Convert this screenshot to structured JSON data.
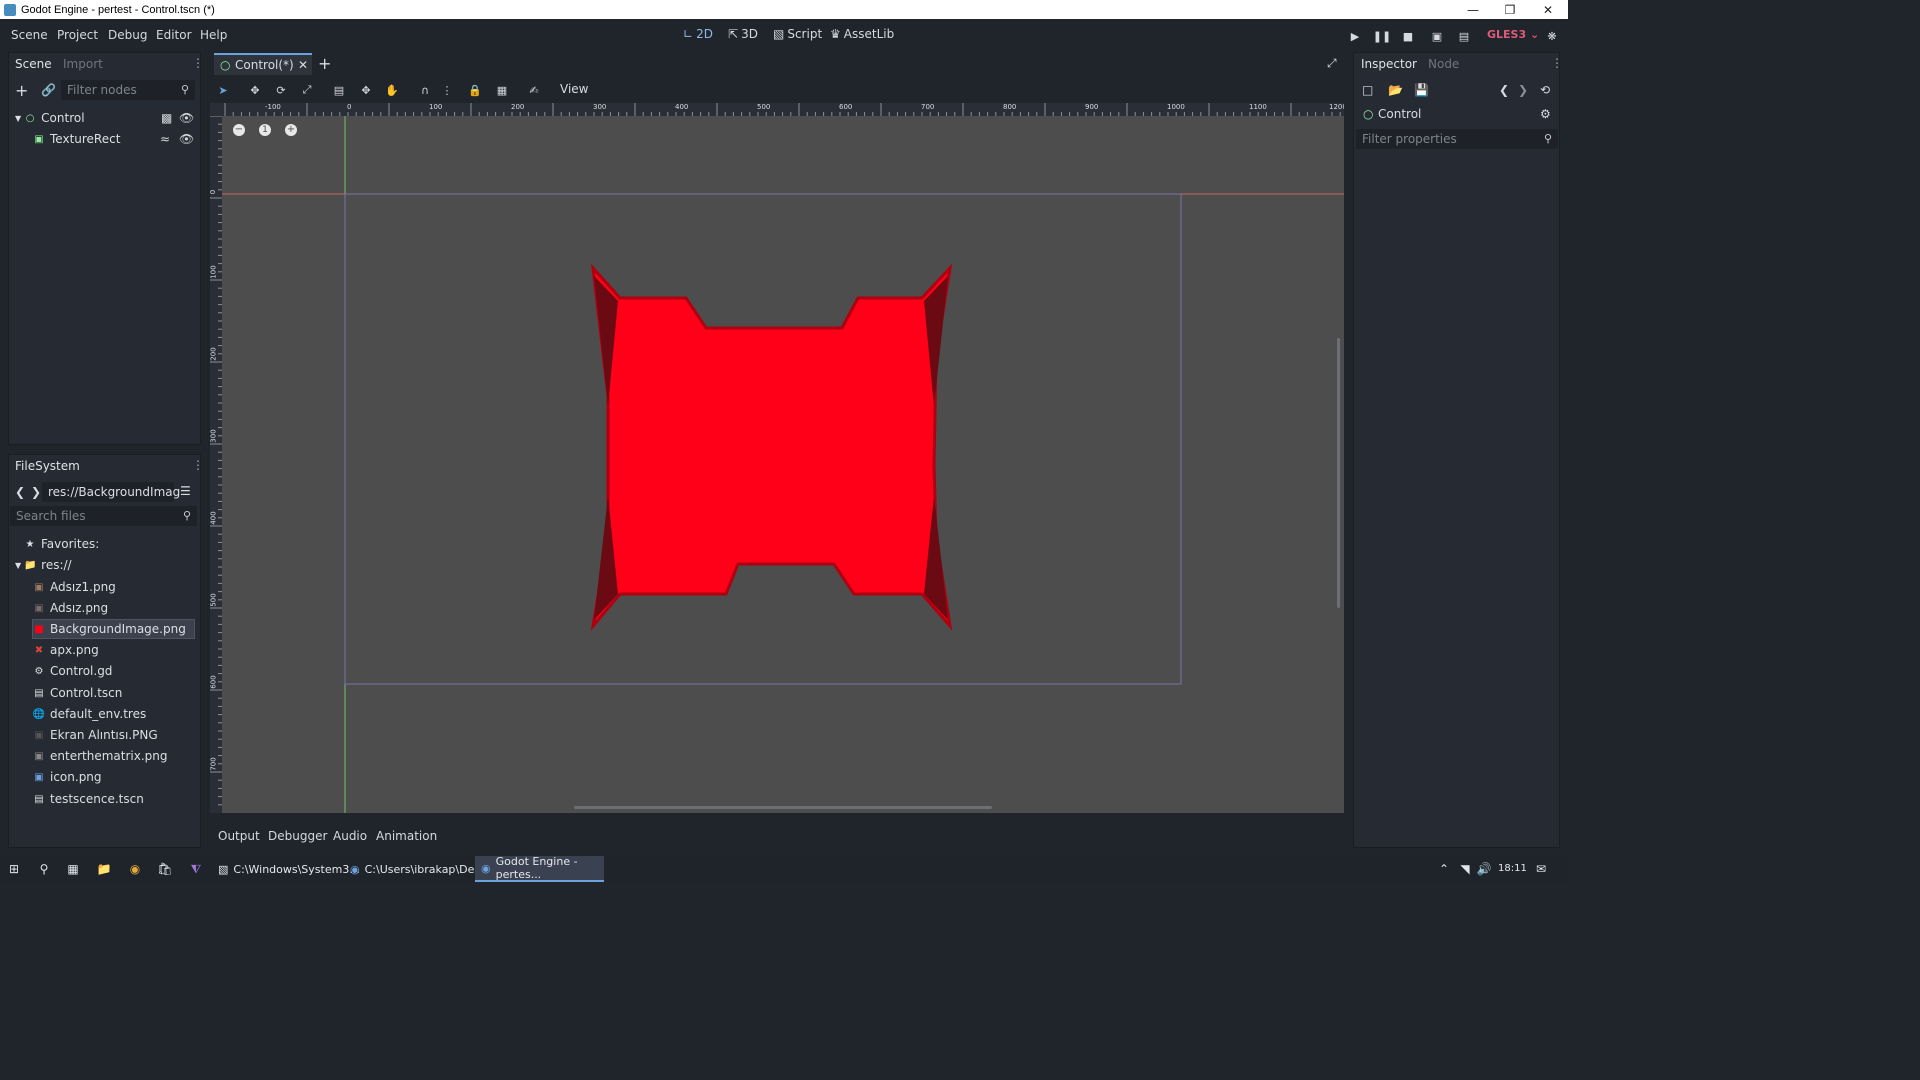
{
  "window": {
    "title": "Godot Engine - pertest - Control.tscn (*)"
  },
  "menu": {
    "items": [
      "Scene",
      "Project",
      "Debug",
      "Editor",
      "Help"
    ]
  },
  "modes": {
    "2d": "2D",
    "3d": "3D",
    "script": "Script",
    "assetlib": "AssetLib"
  },
  "renderer": "GLES3",
  "scene_dock": {
    "tabs": [
      "Scene",
      "Import"
    ],
    "filter_placeholder": "Filter nodes",
    "nodes": [
      {
        "name": "Control",
        "icon": "control-node-icon"
      },
      {
        "name": "TextureRect",
        "icon": "texturerect-node-icon"
      }
    ]
  },
  "filesystem": {
    "title": "FileSystem",
    "path": "res://BackgroundImag",
    "search_placeholder": "Search files",
    "favorites": "Favorites:",
    "root": "res://",
    "files": [
      {
        "name": "Adsız1.png",
        "icon": "image-icon"
      },
      {
        "name": "Adsız.png",
        "icon": "image-icon"
      },
      {
        "name": "BackgroundImage.png",
        "icon": "image-icon",
        "selected": true
      },
      {
        "name": "apx.png",
        "icon": "image-icon"
      },
      {
        "name": "Control.gd",
        "icon": "gear-icon"
      },
      {
        "name": "Control.tscn",
        "icon": "scene-icon"
      },
      {
        "name": "default_env.tres",
        "icon": "environment-icon"
      },
      {
        "name": "Ekran Alıntısı.PNG",
        "icon": "image-icon"
      },
      {
        "name": "enterthematrix.png",
        "icon": "image-icon"
      },
      {
        "name": "icon.png",
        "icon": "image-icon"
      },
      {
        "name": "testscence.tscn",
        "icon": "scene-icon"
      }
    ]
  },
  "editor_tabs": {
    "current": "Control(*)"
  },
  "viewport": {
    "view_menu": "View",
    "ruler_h": [
      "-100",
      "0",
      "100",
      "200",
      "300",
      "400",
      "500",
      "600",
      "700",
      "800",
      "900",
      "1000",
      "1100",
      "1200"
    ],
    "ruler_v": [
      "0",
      "100",
      "200",
      "300",
      "400",
      "500",
      "600",
      "700"
    ],
    "colors": {
      "canvas": "#4d4d4d",
      "shape": "#ff0018",
      "shape_dark": "#6b0a12"
    }
  },
  "bottom_panel": {
    "tabs": [
      "Output",
      "Debugger",
      "Audio",
      "Animation"
    ]
  },
  "inspector": {
    "tabs": [
      "Inspector",
      "Node"
    ],
    "object": "Control",
    "filter_placeholder": "Filter properties"
  },
  "taskbar": {
    "apps": [
      {
        "label": "C:\\Windows\\System3..."
      },
      {
        "label": "C:\\Users\\ibrakap\\Des..."
      },
      {
        "label": "Godot Engine - pertes...",
        "active": true
      }
    ],
    "time": "18:11"
  }
}
